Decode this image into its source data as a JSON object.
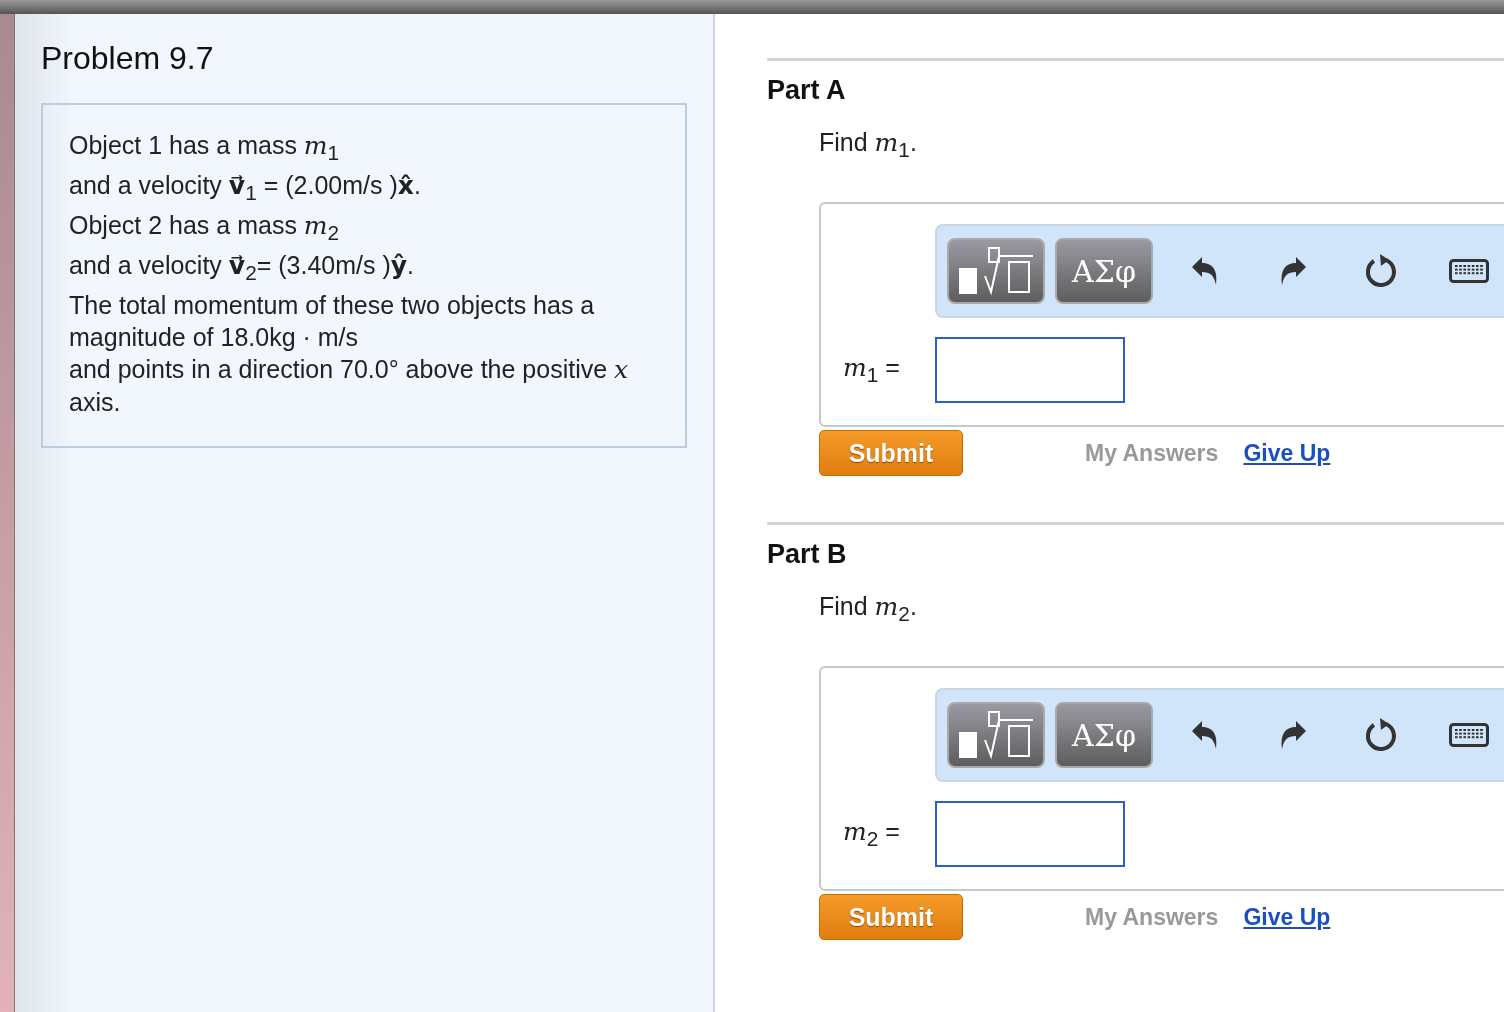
{
  "problem": {
    "title": "Problem 9.7",
    "statement": [
      "Object 1 has a mass *m*$_{1}$",
      "and a velocity **v⃗**$_{1}$ = (2.00m/s )**x̂**.",
      "Object 2 has a mass *m*$_{2}$",
      "and a velocity **v⃗**$_{2}$= (3.40m/s )**ŷ**.",
      "The total momentum of these two objects has a",
      "magnitude of 18.0kg · m/s",
      "and points in a direction 70.0° above the positive *x*",
      "axis."
    ]
  },
  "parts": [
    {
      "title": "Part A",
      "prompt": "Find *m*$_{1}$.",
      "symbols_button": "ΑΣφ",
      "answer_label": "*m*$_{1}$ =",
      "submit": "Submit",
      "my_answers": "My Answers",
      "give_up": "Give Up"
    },
    {
      "title": "Part B",
      "prompt": "Find *m*$_{2}$.",
      "symbols_button": "ΑΣφ",
      "answer_label": "*m*$_{2}$ =",
      "submit": "Submit",
      "my_answers": "My Answers",
      "give_up": "Give Up"
    }
  ]
}
